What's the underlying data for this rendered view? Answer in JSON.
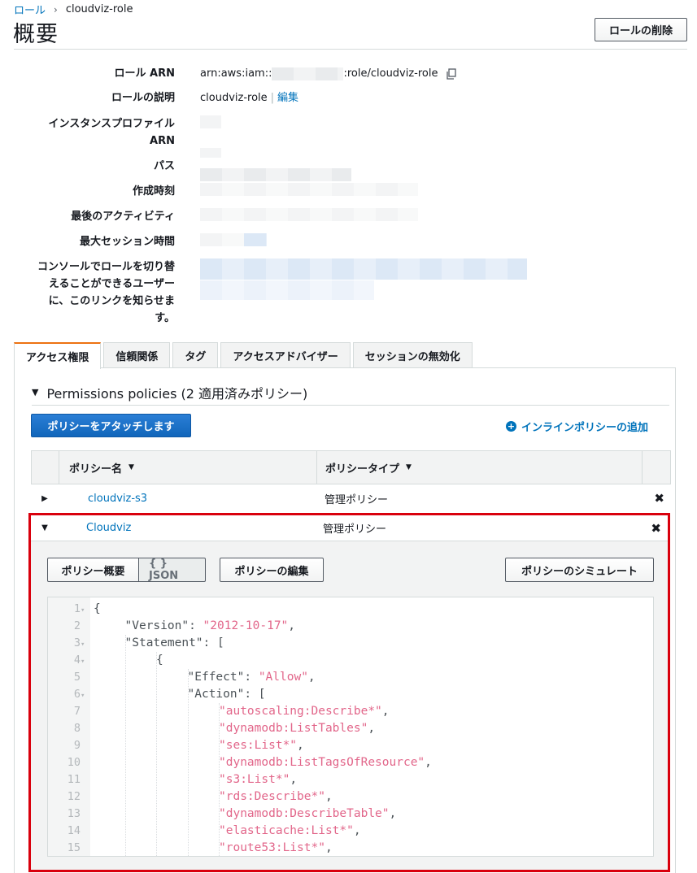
{
  "breadcrumb": {
    "parent": "ロール",
    "separator": "›",
    "current": "cloudviz-role"
  },
  "page": {
    "title": "概要",
    "delete_button": "ロールの削除"
  },
  "summary": {
    "role_arn_label": "ロール ARN",
    "role_arn_prefix": "arn:aws:iam::",
    "role_arn_suffix": ":role/cloudviz-role",
    "description_label": "ロールの説明",
    "description_value": "cloudviz-role",
    "edit_link": "編集",
    "instance_profile_label": "インスタンスプロファイル ARN",
    "path_label": "パス",
    "created_label": "作成時刻",
    "last_activity_label": "最後のアクティビティ",
    "max_session_label": "最大セッション時間",
    "console_link_label": "コンソールでロールを切り替えることができるユーザーに、このリンクを知らせます。"
  },
  "tabs": [
    "アクセス権限",
    "信頼関係",
    "タグ",
    "アクセスアドバイザー",
    "セッションの無効化"
  ],
  "permissions": {
    "header": "Permissions policies (2 適用済みポリシー)",
    "attach_button": "ポリシーをアタッチします",
    "inline_add": "インラインポリシーの追加",
    "columns": [
      "ポリシー名",
      "ポリシータイプ"
    ],
    "rows": [
      {
        "name": "cloudviz-s3",
        "type": "管理ポリシー"
      },
      {
        "name": "Cloudviz",
        "type": "管理ポリシー"
      }
    ]
  },
  "policy_detail": {
    "summary_tab": "ポリシー概要",
    "json_tab": "{ } JSON",
    "edit_button": "ポリシーの編集",
    "simulate_button": "ポリシーのシミュレート",
    "code_lines": [
      {
        "n": "1",
        "fold": true,
        "indent": 0,
        "key": "",
        "text": "{",
        "str": "",
        "tail": ""
      },
      {
        "n": "2",
        "fold": false,
        "indent": 1,
        "text": "\"Version\": ",
        "str": "\"2012-10-17\"",
        "tail": ","
      },
      {
        "n": "3",
        "fold": true,
        "indent": 1,
        "text": "\"Statement\": [",
        "str": "",
        "tail": ""
      },
      {
        "n": "4",
        "fold": true,
        "indent": 2,
        "text": "{",
        "str": "",
        "tail": ""
      },
      {
        "n": "5",
        "fold": false,
        "indent": 3,
        "text": "\"Effect\": ",
        "str": "\"Allow\"",
        "tail": ","
      },
      {
        "n": "6",
        "fold": true,
        "indent": 3,
        "text": "\"Action\": [",
        "str": "",
        "tail": ""
      },
      {
        "n": "7",
        "fold": false,
        "indent": 4,
        "text": "",
        "str": "\"autoscaling:Describe*\"",
        "tail": ","
      },
      {
        "n": "8",
        "fold": false,
        "indent": 4,
        "text": "",
        "str": "\"dynamodb:ListTables\"",
        "tail": ","
      },
      {
        "n": "9",
        "fold": false,
        "indent": 4,
        "text": "",
        "str": "\"ses:List*\"",
        "tail": ","
      },
      {
        "n": "10",
        "fold": false,
        "indent": 4,
        "text": "",
        "str": "\"dynamodb:ListTagsOfResource\"",
        "tail": ","
      },
      {
        "n": "11",
        "fold": false,
        "indent": 4,
        "text": "",
        "str": "\"s3:List*\"",
        "tail": ","
      },
      {
        "n": "12",
        "fold": false,
        "indent": 4,
        "text": "",
        "str": "\"rds:Describe*\"",
        "tail": ","
      },
      {
        "n": "13",
        "fold": false,
        "indent": 4,
        "text": "",
        "str": "\"dynamodb:DescribeTable\"",
        "tail": ","
      },
      {
        "n": "14",
        "fold": false,
        "indent": 4,
        "text": "",
        "str": "\"elasticache:List*\"",
        "tail": ","
      },
      {
        "n": "15",
        "fold": false,
        "indent": 4,
        "text": "",
        "str": "\"route53:List*\"",
        "tail": ","
      }
    ]
  },
  "colors": {
    "link": "#0073bb",
    "primary": "#1166bb",
    "tab_accent": "#ec7211",
    "highlight_border": "#d9000d",
    "json_string": "#e2668a"
  }
}
